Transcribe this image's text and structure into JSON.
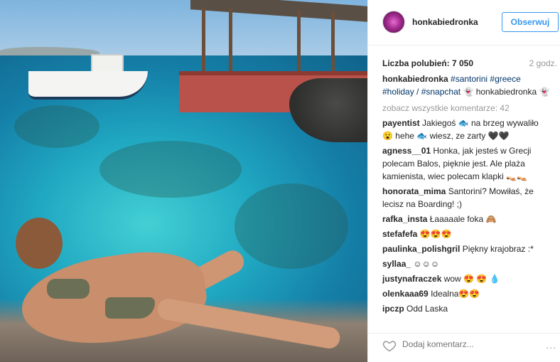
{
  "post": {
    "username": "honkabiedronka",
    "follow_label": "Obserwuj",
    "likes_label": "Liczba polubień: 7 050",
    "time": "2 godz."
  },
  "caption": {
    "username": "honkabiedronka",
    "tags": "#santorini #greece #holiday / #snapchat",
    "text": "👻 honkabiedronka 👻"
  },
  "load_more": "zobacz wszystkie komentarze: 42",
  "comments": [
    {
      "user": "payentist",
      "text": "Jakiegoś 🐟 na brzeg wywaliło 😮 hehe 🐟 wiesz, ze zarty 🖤🖤"
    },
    {
      "user": "agness__01",
      "text": "Honka, jak jesteś w Grecji polecam Balos, pięknie jest. Ale plaża kamienista, wiec polecam klapki 👡👡"
    },
    {
      "user": "honorata_mima",
      "text": "Santorini? Mowiłaś, że lecisz na Boarding! ;)"
    },
    {
      "user": "rafka_insta",
      "text": "Łaaaaale foka 🙈"
    },
    {
      "user": "stefafefa",
      "text": "😍😍😍"
    },
    {
      "user": "paulinka_polishgril",
      "text": "Piękny krajobraz :*"
    },
    {
      "user": "syllaa_",
      "text": "☺☺☺"
    },
    {
      "user": "justynafraczek",
      "text": "wow 😍 😍 💧"
    },
    {
      "user": "olenkaaa69",
      "text": "Idealna😍😍"
    },
    {
      "user": "ipczp",
      "text": "Odd Laska"
    }
  ],
  "footer": {
    "add_comment_placeholder": "Dodaj komentarz...",
    "more_label": "...",
    "heart_icon": "heart-icon"
  }
}
